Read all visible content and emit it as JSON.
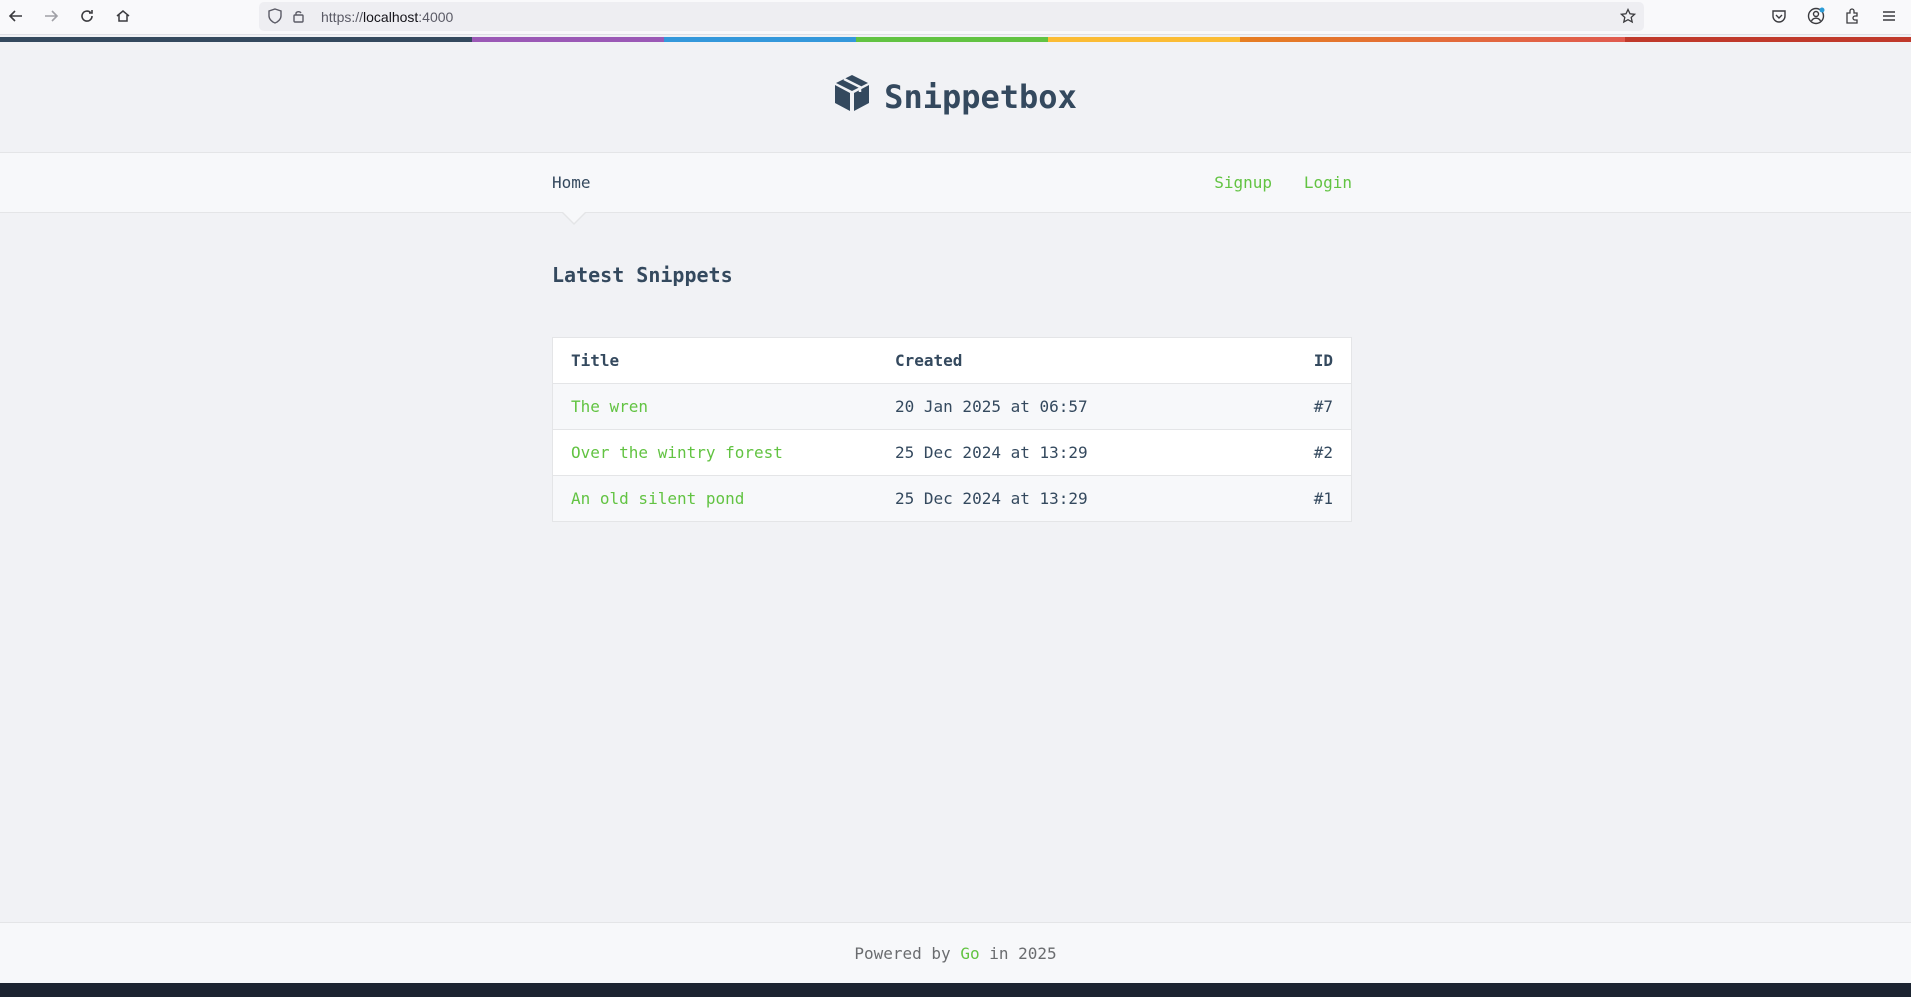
{
  "browser": {
    "url_prefix": "https://",
    "url_host": "localhost",
    "url_port": ":4000"
  },
  "header": {
    "app_name": "Snippetbox"
  },
  "nav": {
    "home": "Home",
    "signup": "Signup",
    "login": "Login"
  },
  "main": {
    "title": "Latest Snippets",
    "table": {
      "headers": {
        "title": "Title",
        "created": "Created",
        "id": "ID"
      },
      "rows": [
        {
          "title": "The wren",
          "created": "20 Jan 2025 at 06:57",
          "id": "#7"
        },
        {
          "title": "Over the wintry forest",
          "created": "25 Dec 2024 at 13:29",
          "id": "#2"
        },
        {
          "title": "An old silent pond",
          "created": "25 Dec 2024 at 13:29",
          "id": "#1"
        }
      ]
    }
  },
  "footer": {
    "prefix": "Powered by",
    "link": "Go",
    "suffix": "in 2025"
  },
  "colors": {
    "accent": "#62c342",
    "primary": "#34495e",
    "background": "#f1f2f5"
  }
}
